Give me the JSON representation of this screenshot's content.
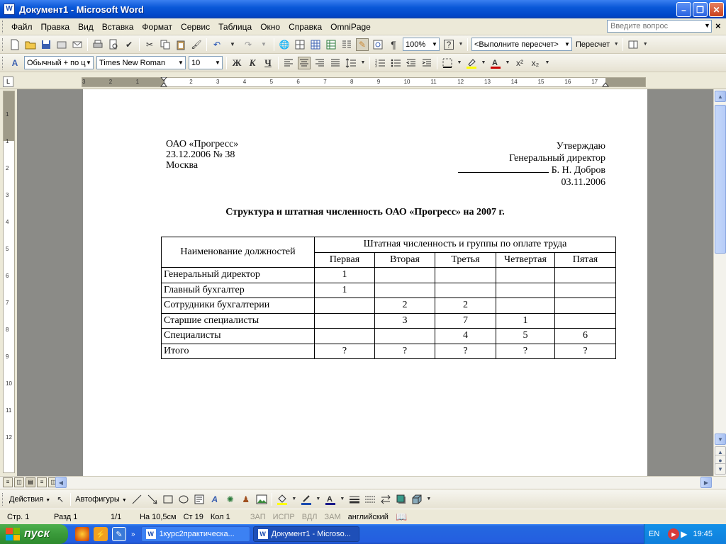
{
  "window": {
    "title": "Документ1 - Microsoft Word",
    "app_icon": "W"
  },
  "menu": {
    "items": [
      "Файл",
      "Правка",
      "Вид",
      "Вставка",
      "Формат",
      "Сервис",
      "Таблица",
      "Окно",
      "Справка",
      "OmniPage"
    ],
    "help_placeholder": "Введите вопрос"
  },
  "toolbar1": {
    "zoom": "100%",
    "field_dropdown": "<Выполните пересчет>",
    "refresh_label": "Пересчет"
  },
  "toolbar2": {
    "style": "Обычный + по ц",
    "font": "Times New Roman",
    "size": "10",
    "bold": "Ж",
    "italic": "К",
    "underline": "Ч"
  },
  "ruler": {
    "h_ticks": [
      "3",
      "2",
      "1",
      "1",
      "2",
      "3",
      "4",
      "5",
      "6",
      "7",
      "8",
      "9",
      "10",
      "11",
      "12",
      "13",
      "14",
      "15",
      "16",
      "17"
    ],
    "v_ticks": [
      "1",
      "1",
      "2",
      "3",
      "4",
      "5",
      "6",
      "7",
      "8",
      "9",
      "10",
      "11",
      "12"
    ]
  },
  "document": {
    "org": "ОАО «Прогресс»",
    "doc_date": "23.12.2006 № 38",
    "city": "Москва",
    "approve": "Утверждаю",
    "position": "Генеральный директор",
    "signer": "Б. Н. Добров",
    "approve_date": "03.11.2006",
    "title": "Структура и штатная численность ОАО «Прогресс» на 2007 г.",
    "table": {
      "col0_header": "Наименование должностей",
      "group_header": "Штатная численность и группы по оплате труда",
      "groups": [
        "Первая",
        "Вторая",
        "Третья",
        "Четвертая",
        "Пятая"
      ],
      "rows": [
        {
          "name": "Генеральный директор",
          "values": [
            "1",
            "",
            "",
            "",
            ""
          ]
        },
        {
          "name": "Главный бухгалтер",
          "values": [
            "1",
            "",
            "",
            "",
            ""
          ]
        },
        {
          "name": "Сотрудники бухгалтерии",
          "values": [
            "",
            "2",
            "2",
            "",
            ""
          ]
        },
        {
          "name": "Старшие специалисты",
          "values": [
            "",
            "3",
            "7",
            "1",
            ""
          ]
        },
        {
          "name": "Специалисты",
          "values": [
            "",
            "",
            "4",
            "5",
            "6"
          ]
        },
        {
          "name": "Итого",
          "values": [
            "?",
            "?",
            "?",
            "?",
            "?"
          ]
        }
      ]
    }
  },
  "drawbar": {
    "actions": "Действия",
    "autoshapes": "Автофигуры"
  },
  "status": {
    "page": "Стр. 1",
    "section": "Разд 1",
    "pages": "1/1",
    "at": "На 10,5см",
    "line": "Ст 19",
    "col": "Кол 1",
    "rec": "ЗАП",
    "trk": "ИСПР",
    "ext": "ВДЛ",
    "ovr": "ЗАМ",
    "lang": "английский"
  },
  "taskbar": {
    "start": "пуск",
    "tasks": [
      "1курс2практическа...",
      "Документ1 - Microso..."
    ],
    "lang": "EN",
    "clock": "19:45"
  },
  "colors": {
    "title_blue": "#0046c8",
    "taskbar_blue": "#245ee0",
    "start_green": "#3a9a3a"
  }
}
